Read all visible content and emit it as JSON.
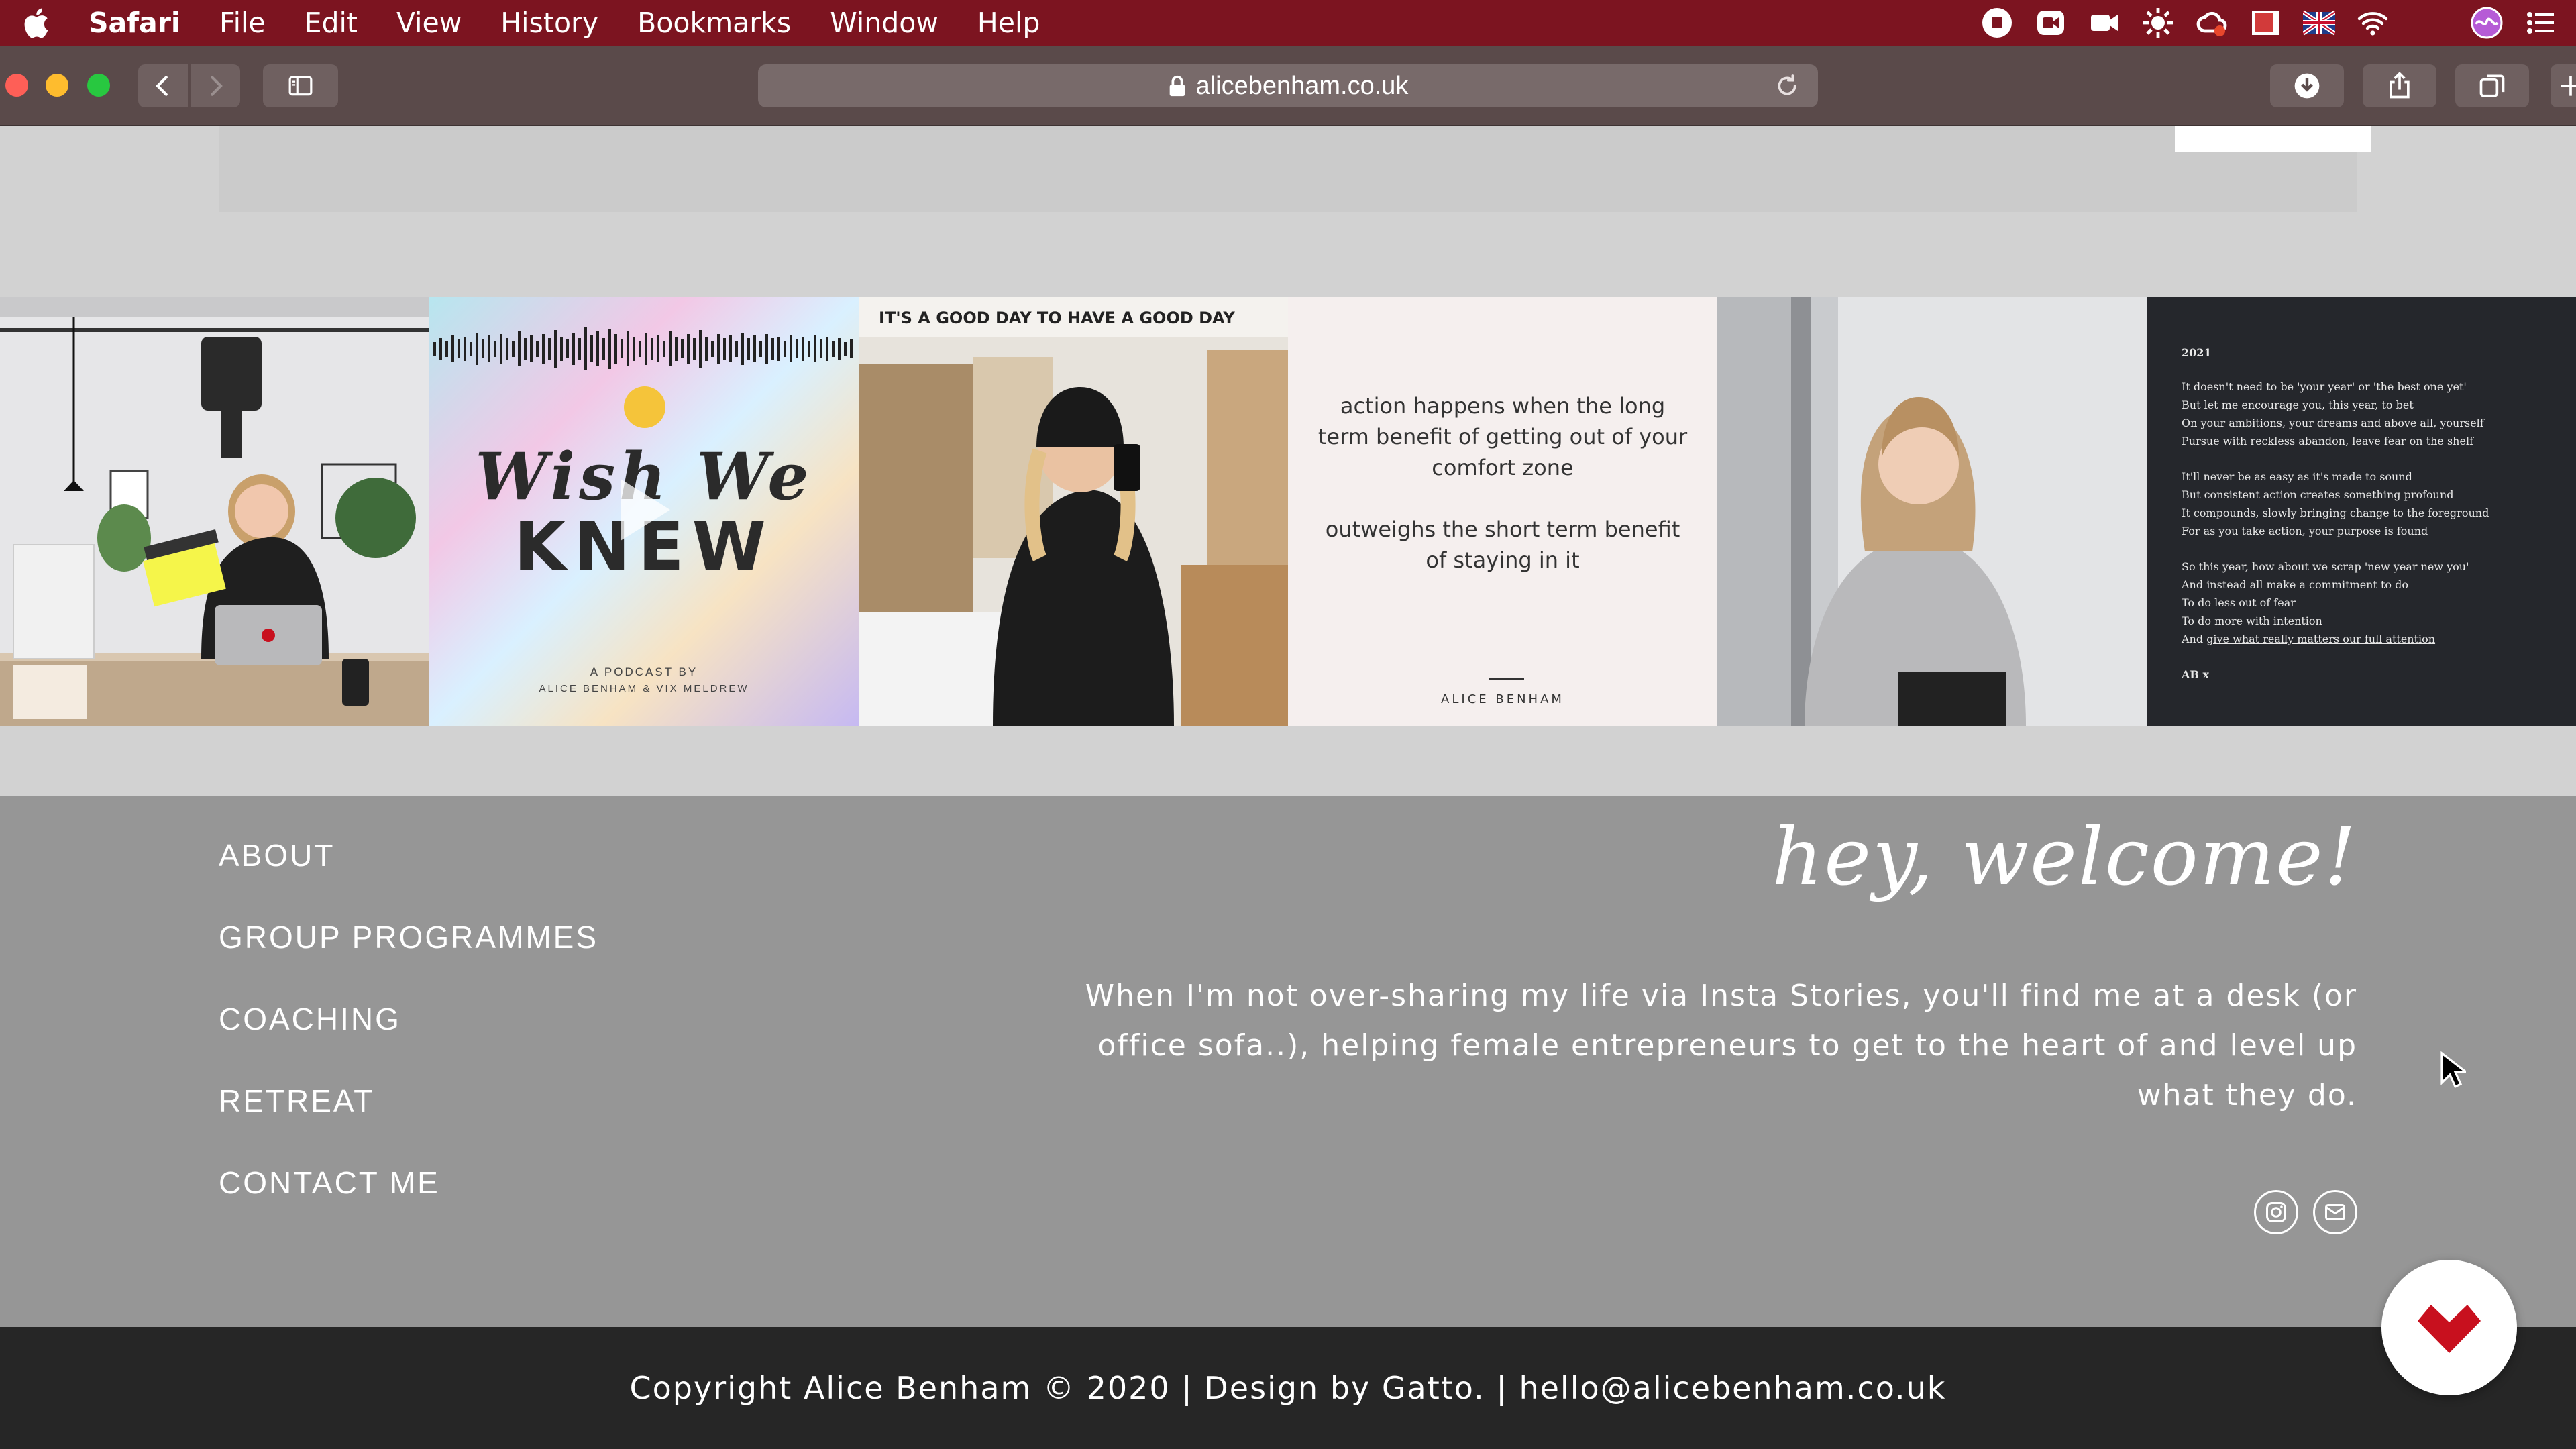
{
  "menubar": {
    "app_name": "Safari",
    "items": [
      "File",
      "Edit",
      "View",
      "History",
      "Bookmarks",
      "Window",
      "Help"
    ],
    "status_icons": [
      "stop-record-icon",
      "facetime-icon",
      "video-icon",
      "settings-sun-icon",
      "creative-cloud-icon",
      "screen-mirror-icon",
      "uk-flag-icon",
      "wifi-icon",
      "siri-icon",
      "control-center-icon"
    ]
  },
  "browser": {
    "url": "alicebenham.co.uk"
  },
  "gallery": {
    "podcast": {
      "title_line1": "Wish We",
      "title_line2": "KNEW",
      "sub_line1": "A PODCAST BY",
      "sub_line2": "ALICE BENHAM & VIX MELDREW"
    },
    "selfie_caption": "IT'S A GOOD DAY  TO HAVE A GOOD DAY",
    "quote": {
      "part1": "action happens when the long term benefit of getting out of your comfort zone",
      "part2": "outweighs the short term benefit of staying in it",
      "signature": "ALICE BENHAM"
    },
    "poem": {
      "year": "2021",
      "stanza1": [
        "It doesn't need to be 'your year' or 'the best one yet'",
        "But let me encourage you, this year, to bet",
        "On your ambitions, your dreams and above all, yourself",
        "Pursue with reckless abandon, leave fear on the shelf"
      ],
      "stanza2": [
        "It'll never be as easy as it's made to sound",
        "But consistent action creates something profound",
        "It compounds, slowly bringing change to the foreground",
        "For as you take action, your purpose is found"
      ],
      "stanza3": [
        "So this year, how about we scrap 'new year new you'",
        "And instead all make a commitment to do",
        "To do less out of fear",
        "To do more with intention"
      ],
      "last_line_prefix": "And ",
      "last_line_link": "give what really matters our full attention",
      "signoff": "AB x"
    }
  },
  "footer": {
    "nav": [
      "ABOUT",
      "GROUP PROGRAMMES",
      "COACHING",
      "RETREAT",
      "CONTACT ME"
    ],
    "greeting": "hey, welcome!",
    "about": "When I'm not over-sharing my life via Insta Stories, you'll find me at a desk (or office sofa..), helping female entrepreneurs to get to the heart of and level up what they do.",
    "copyright": "Copyright Alice Benham © 2020 | Design by Gatto. | hello@alicebenham.co.uk"
  },
  "colors": {
    "menubar": "#7c1420",
    "toolbar": "#5a4a4a",
    "footer": "#969696",
    "copyright_bar": "#262626",
    "fab_logo": "#c8101e"
  }
}
